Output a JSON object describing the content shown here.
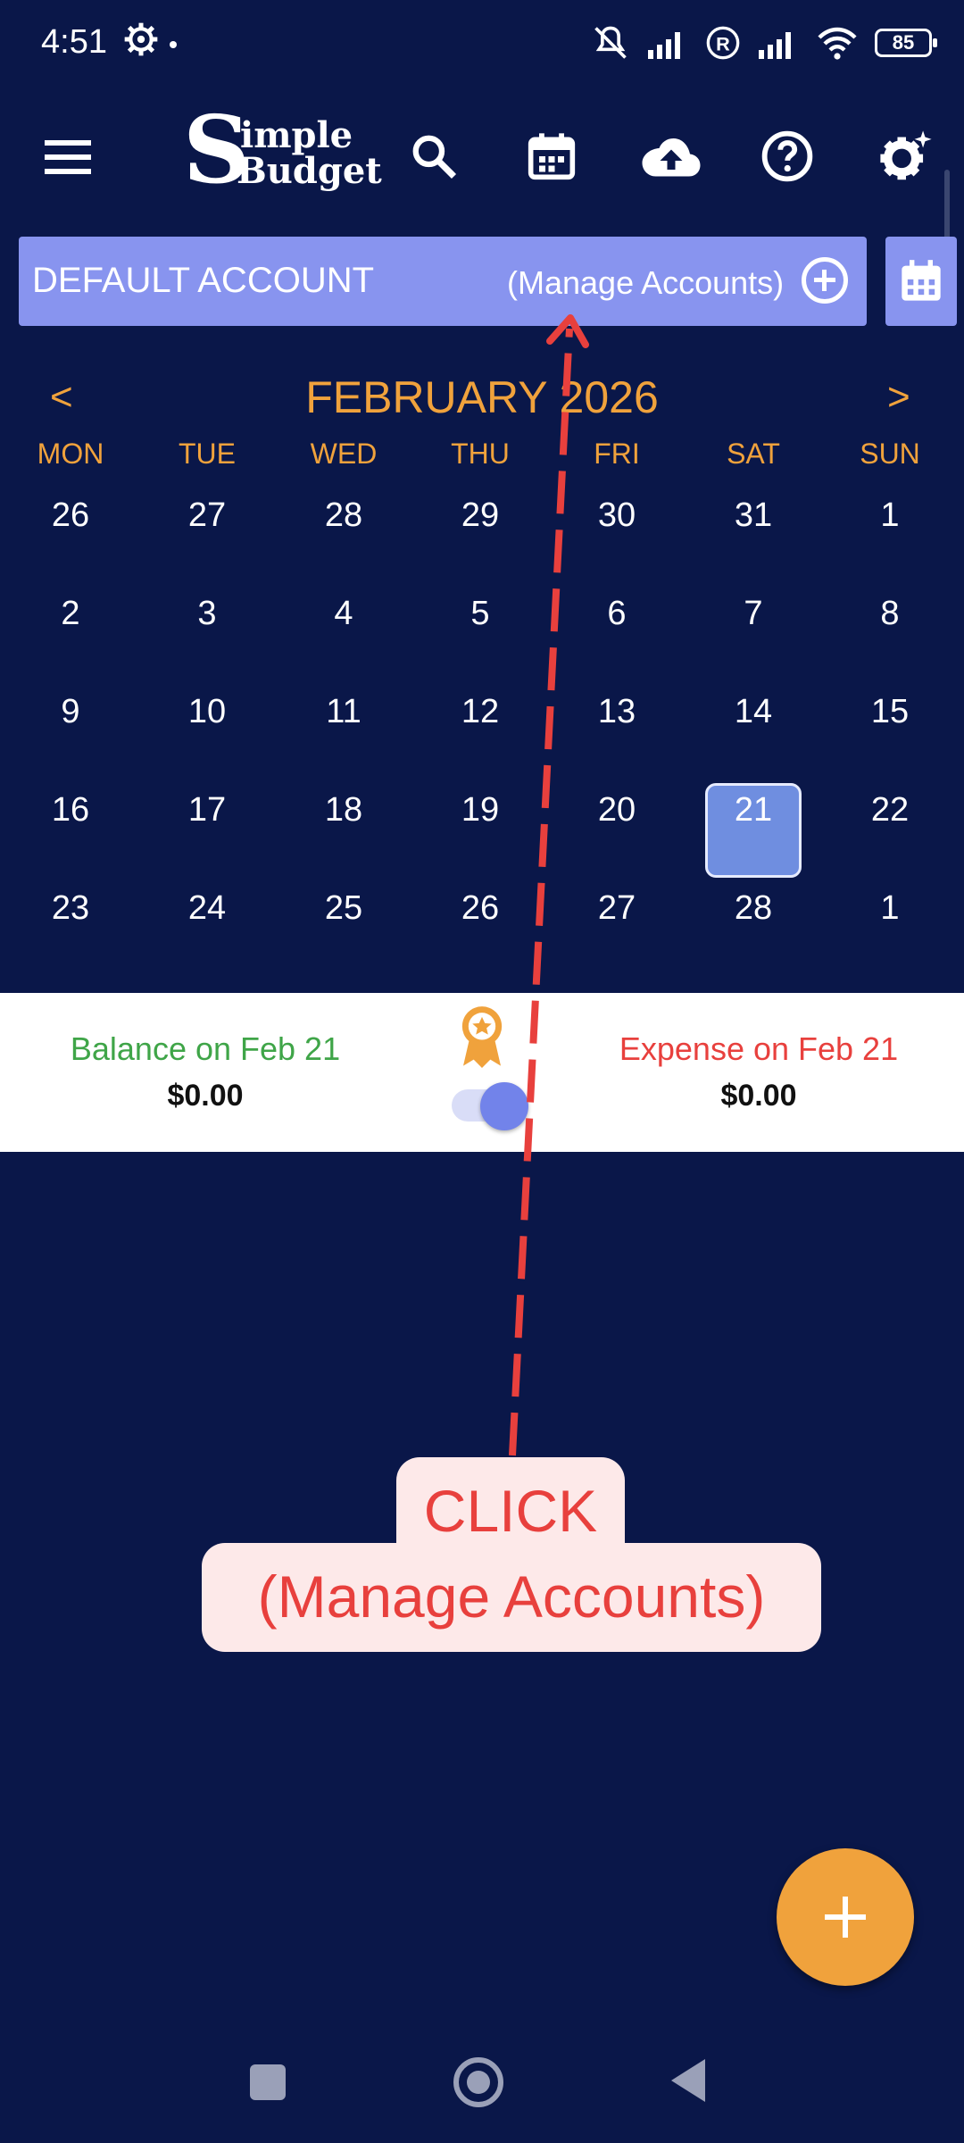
{
  "status_bar": {
    "time": "4:51",
    "battery": "85"
  },
  "account": {
    "name": "DEFAULT ACCOUNT",
    "manage_label": "(Manage Accounts)"
  },
  "calendar": {
    "prev": "<",
    "next": ">",
    "month_title": "FEBRUARY 2026",
    "weekdays": [
      "MON",
      "TUE",
      "WED",
      "THU",
      "FRI",
      "SAT",
      "SUN"
    ],
    "weeks": [
      [
        "26",
        "27",
        "28",
        "29",
        "30",
        "31",
        "1"
      ],
      [
        "2",
        "3",
        "4",
        "5",
        "6",
        "7",
        "8"
      ],
      [
        "9",
        "10",
        "11",
        "12",
        "13",
        "14",
        "15"
      ],
      [
        "16",
        "17",
        "18",
        "19",
        "20",
        "21",
        "22"
      ],
      [
        "23",
        "24",
        "25",
        "26",
        "27",
        "28",
        "1"
      ]
    ],
    "selected_day": "21"
  },
  "summary": {
    "balance_label": "Balance on Feb 21",
    "balance_value": "$0.00",
    "expense_label": "Expense on Feb 21",
    "expense_value": "$0.00"
  },
  "annotation": {
    "line1": "CLICK",
    "line2": "(Manage Accounts)",
    "color": "#e8403d"
  },
  "colors": {
    "background": "#0a1749",
    "accent": "#f0a23c",
    "account_bar": "#8894ef"
  },
  "icons": [
    "menu-icon",
    "search-icon",
    "calendar-icon",
    "cloud-upload-icon",
    "help-icon",
    "settings-sparkle-icon"
  ]
}
